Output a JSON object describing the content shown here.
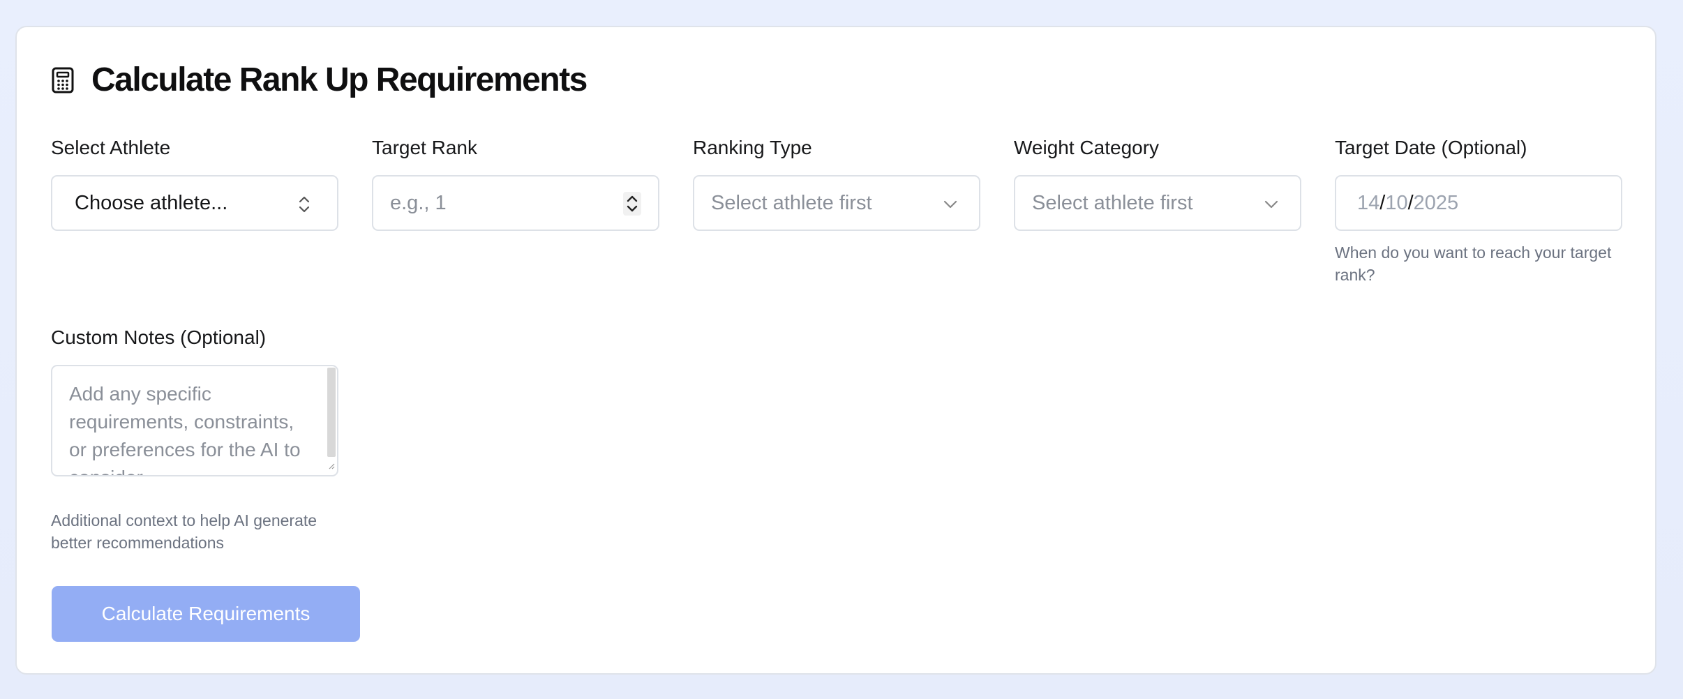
{
  "form": {
    "title": "Calculate Rank Up Requirements",
    "title_icon": "calculator-icon",
    "athlete": {
      "label": "Select Athlete",
      "value": "Choose athlete..."
    },
    "target_rank": {
      "label": "Target Rank",
      "placeholder": "e.g., 1"
    },
    "ranking_type": {
      "label": "Ranking Type",
      "value": "Select athlete first"
    },
    "weight_category": {
      "label": "Weight Category",
      "value": "Select athlete first"
    },
    "target_date": {
      "label": "Target Date (Optional)",
      "day": "14",
      "month": "10",
      "year": "2025",
      "separator": "/",
      "helper": "When do you want to reach your target rank?"
    },
    "custom_notes": {
      "label": "Custom Notes (Optional)",
      "placeholder": "Add any specific requirements, constraints, or preferences for the AI to consider",
      "helper": "Additional context to help AI generate better recommendations"
    },
    "submit_label": "Calculate Requirements"
  },
  "colors": {
    "button_bg": "#93adf4",
    "page_bg": "#e9effd",
    "placeholder": "#8a8f98"
  }
}
